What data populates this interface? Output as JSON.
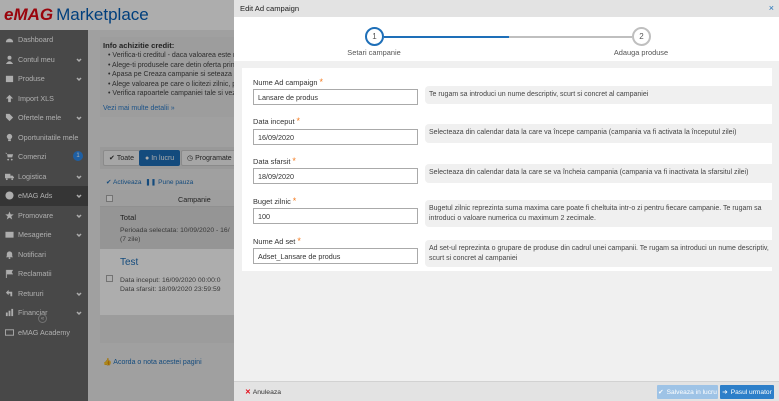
{
  "brand": {
    "logo_e": "e",
    "logo_mag": "MAG",
    "logo_suffix": "Marketplace"
  },
  "colors": {
    "accent": "#1e6fb8",
    "brand_red": "#e30613",
    "required": "#f47b20",
    "sidebar_bg": "#6b6b6b"
  },
  "sidebar": {
    "items": [
      {
        "label": "Dashboard",
        "icon": "gauge-icon"
      },
      {
        "label": "Contul meu",
        "icon": "user-icon",
        "chevron": true
      },
      {
        "label": "Produse",
        "icon": "box-icon",
        "chevron": true
      },
      {
        "label": "Import XLS",
        "icon": "upload-icon"
      },
      {
        "label": "Ofertele mele",
        "icon": "tag-icon",
        "chevron": true
      },
      {
        "label": "Oportunitatile mele",
        "icon": "lightbulb-icon"
      },
      {
        "label": "Comenzi",
        "icon": "cart-icon",
        "count": "1"
      },
      {
        "label": "Logistica",
        "icon": "truck-icon",
        "chevron": true
      },
      {
        "label": "eMAG Ads",
        "icon": "target-icon",
        "chevron": true,
        "active": true
      },
      {
        "label": "Promovare",
        "icon": "star-icon",
        "chevron": true
      },
      {
        "label": "Mesagerie",
        "icon": "envelope-icon",
        "chevron": true
      },
      {
        "label": "Notificari",
        "icon": "bell-icon"
      },
      {
        "label": "Reclamatii",
        "icon": "flag-icon"
      },
      {
        "label": "Retururi",
        "icon": "return-icon",
        "chevron": true
      },
      {
        "label": "Financiar",
        "icon": "chart-icon",
        "chevron": true
      },
      {
        "label": "eMAG Academy",
        "icon": "academy-icon"
      }
    ],
    "collapse_glyph": "«"
  },
  "background": {
    "info_title": "Info achizitie credit:",
    "info_items": [
      "Verifica-ti creditul - daca valoarea este m",
      "Alege-ti produsele care detin oferta princ",
      "Apasa pe Creaza campanie si seteaza pe",
      "Alege valoarea pe care o licitezi zilnic, pe",
      "Verifica rapoartele campaniei tale si vezi"
    ],
    "info_link": "Vezi mai multe detalii »",
    "filters": {
      "all": "Toate",
      "running": "In lucru",
      "scheduled": "Programate"
    },
    "actions": {
      "activate": "Activeaza",
      "pause": "Pune pauza"
    },
    "table_header": "Campanie",
    "total_label": "Total",
    "total_period": "Perioada selectata: 10/09/2020 - 16/",
    "total_days": "(7 zile)",
    "campaign_name": "Test",
    "campaign_start": "Data inceput: 16/09/2020 00:00:0",
    "campaign_end": "Data sfarsit: 18/09/2020 23:59:59",
    "agreement": "Acorda o nota acestei pagini"
  },
  "modal": {
    "title": "Edit Ad campaign",
    "close_glyph": "×",
    "steps": [
      {
        "number": "1",
        "label": "Setari campanie"
      },
      {
        "number": "2",
        "label": "Adauga produse"
      }
    ],
    "fields": [
      {
        "label": "Nume Ad campaign",
        "value": "Lansare de produs",
        "help": "Te rugam sa introduci un nume descriptiv, scurt si concret al campaniei"
      },
      {
        "label": "Data inceput",
        "value": "16/09/2020",
        "help": "Selecteaza din calendar data la care va începe campania (campania va fi activata la începutul zilei)"
      },
      {
        "label": "Data sfarsit",
        "value": "18/09/2020",
        "help": "Selecteaza din calendar data la care se va încheia campania (campania va fi inactivata la sfarsitul zilei)"
      },
      {
        "label": "Buget zilnic",
        "value": "100",
        "help": "Bugetul zilnic reprezinta suma maxima care poate fi cheltuita intr-o zi pentru fiecare campanie. Te rugam sa introduci o valoare numerica cu maximum 2 zecimale."
      },
      {
        "label": "Nume Ad set",
        "value": "Adset_Lansare de produs",
        "help": "Ad set-ul reprezinta o grupare de produse din cadrul unei campanii. Te rugam sa introduci un nume descriptiv, scurt si concret al campaniei"
      }
    ],
    "required_mark": "*",
    "footer": {
      "cancel_label": "Anuleaza",
      "save_label": "Salveaza in lucru",
      "next_label": "Pasul urmator"
    }
  }
}
